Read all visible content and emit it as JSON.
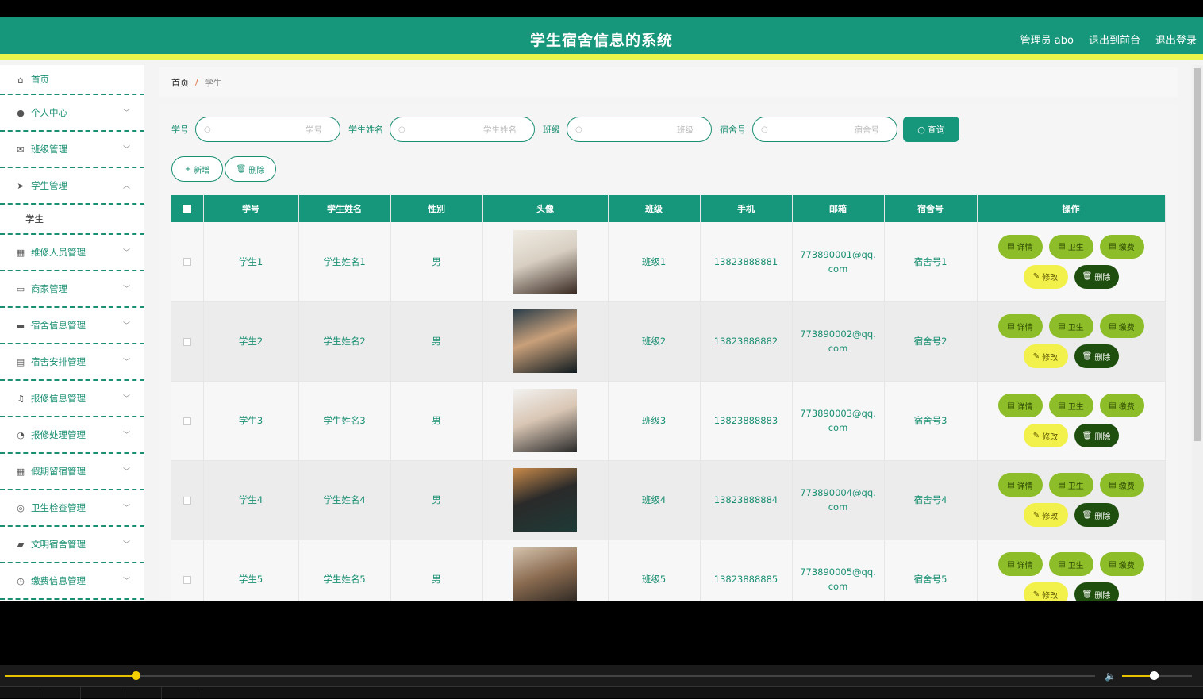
{
  "header": {
    "title": "学生宿舍信息的系统",
    "user": "管理员 abo",
    "back_front": "退出到前台",
    "logout": "退出登录"
  },
  "sidebar": {
    "items": [
      {
        "label": "首页",
        "icon": "home-icon"
      },
      {
        "label": "个人中心",
        "icon": "user-icon"
      },
      {
        "label": "班级管理",
        "icon": "mail-icon"
      },
      {
        "label": "学生管理",
        "icon": "send-icon",
        "expanded": true
      },
      {
        "label": "维修人员管理",
        "icon": "calendar-icon"
      },
      {
        "label": "商家管理",
        "icon": "card-icon"
      },
      {
        "label": "宿舍信息管理",
        "icon": "suitcase-icon"
      },
      {
        "label": "宿舍安排管理",
        "icon": "clipboard-icon"
      },
      {
        "label": "报修信息管理",
        "icon": "bell-off-icon"
      },
      {
        "label": "报修处理管理",
        "icon": "gauge-icon"
      },
      {
        "label": "假期留宿管理",
        "icon": "grid-icon"
      },
      {
        "label": "卫生检查管理",
        "icon": "target-icon"
      },
      {
        "label": "文明宿舍管理",
        "icon": "chat-icon"
      },
      {
        "label": "缴费信息管理",
        "icon": "clock-icon"
      }
    ],
    "sub_item": "学生"
  },
  "breadcrumb": {
    "home": "首页",
    "current": "学生"
  },
  "search": {
    "fields": [
      {
        "label": "学号",
        "placeholder": "学号",
        "value": ""
      },
      {
        "label": "学生姓名",
        "placeholder": "学生姓名",
        "value": ""
      },
      {
        "label": "班级",
        "placeholder": "班级",
        "value": ""
      },
      {
        "label": "宿舍号",
        "placeholder": "宿舍号",
        "value": ""
      }
    ],
    "query_label": "查询"
  },
  "actions": {
    "add_label": "新增",
    "delete_label": "删除"
  },
  "table": {
    "headers": [
      "学号",
      "学生姓名",
      "性别",
      "头像",
      "班级",
      "手机",
      "邮箱",
      "宿舍号",
      "操作"
    ],
    "rows": [
      {
        "id": "学生1",
        "name": "学生姓名1",
        "gender": "男",
        "class": "班级1",
        "phone": "13823888881",
        "email": "773890001@qq.com",
        "dorm": "宿舍号1"
      },
      {
        "id": "学生2",
        "name": "学生姓名2",
        "gender": "男",
        "class": "班级2",
        "phone": "13823888882",
        "email": "773890002@qq.com",
        "dorm": "宿舍号2"
      },
      {
        "id": "学生3",
        "name": "学生姓名3",
        "gender": "男",
        "class": "班级3",
        "phone": "13823888883",
        "email": "773890003@qq.com",
        "dorm": "宿舍号3"
      },
      {
        "id": "学生4",
        "name": "学生姓名4",
        "gender": "男",
        "class": "班级4",
        "phone": "13823888884",
        "email": "773890004@qq.com",
        "dorm": "宿舍号4"
      },
      {
        "id": "学生5",
        "name": "学生姓名5",
        "gender": "男",
        "class": "班级5",
        "phone": "13823888885",
        "email": "773890005@qq.com",
        "dorm": "宿舍号5"
      }
    ],
    "row_buttons": {
      "detail": "详情",
      "hygiene": "卫生",
      "fee": "缴费",
      "edit": "修改",
      "delete": "删除"
    }
  },
  "player": {
    "progress": 0.12,
    "volume": 0.45
  },
  "colors": {
    "primary": "#16967a",
    "accent": "#e9f44d",
    "green_btn": "#8ebd2a",
    "yellow_btn": "#f2f04a",
    "dark_btn": "#1f4f0f"
  }
}
